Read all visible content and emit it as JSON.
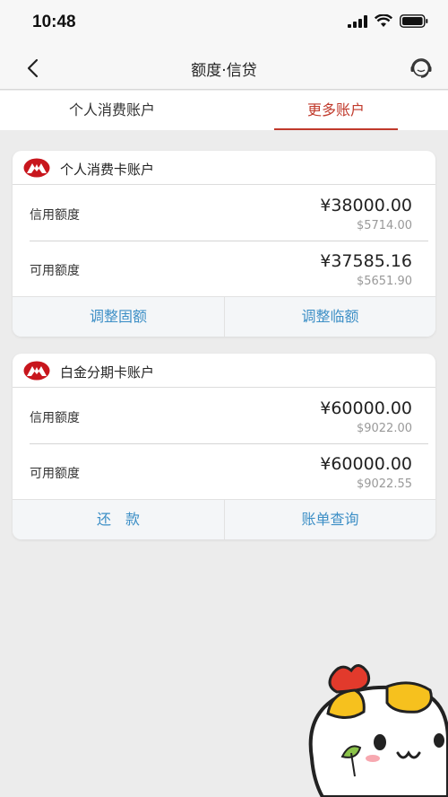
{
  "status": {
    "time": "10:48"
  },
  "nav": {
    "title": "额度·信贷"
  },
  "tabs": [
    {
      "label": "个人消费账户"
    },
    {
      "label": "更多账户"
    }
  ],
  "accounts": [
    {
      "name": "个人消费卡账户",
      "rows": [
        {
          "label": "信用额度",
          "amount": "¥38000.00",
          "usd": "$5714.00"
        },
        {
          "label": "可用额度",
          "amount": "¥37585.16",
          "usd": "$5651.90"
        }
      ],
      "actions": [
        {
          "label": "调整固额"
        },
        {
          "label": "调整临额"
        }
      ]
    },
    {
      "name": "白金分期卡账户",
      "rows": [
        {
          "label": "信用额度",
          "amount": "¥60000.00",
          "usd": "$9022.00"
        },
        {
          "label": "可用额度",
          "amount": "¥60000.00",
          "usd": "$9022.55"
        }
      ],
      "actions": [
        {
          "label": "还　款"
        },
        {
          "label": "账单查询"
        }
      ]
    }
  ],
  "colors": {
    "brand_red": "#c0392b",
    "action_blue": "#3d8fc6"
  },
  "icons": [
    "signal-icon",
    "wifi-icon",
    "battery-icon",
    "back-arrow-icon",
    "customer-service-icon",
    "bank-logo-icon",
    "mascot-sticker"
  ]
}
